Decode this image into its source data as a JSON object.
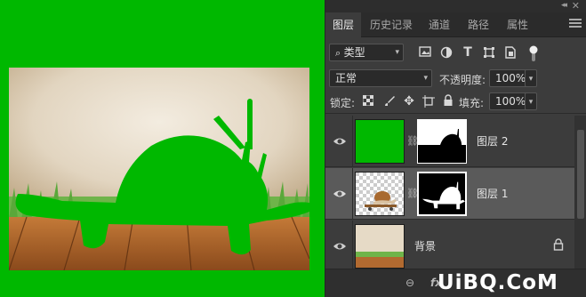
{
  "canvas": {
    "background_color": "#00b800"
  },
  "panel": {
    "tabs": [
      {
        "label": "图层",
        "active": true
      },
      {
        "label": "历史记录",
        "active": false
      },
      {
        "label": "通道",
        "active": false
      },
      {
        "label": "路径",
        "active": false
      },
      {
        "label": "属性",
        "active": false
      }
    ],
    "filter": {
      "label": "类型",
      "icons": [
        "image-filter-icon",
        "adjustment-filter-icon",
        "type-filter-icon",
        "shape-filter-icon",
        "smart-object-filter-icon",
        "filter-toggle-icon"
      ]
    },
    "blend_mode": "正常",
    "opacity": {
      "label": "不透明度:",
      "value": "100%"
    },
    "lock": {
      "label": "锁定:",
      "icons": [
        "lock-transparent-icon",
        "lock-pixels-icon",
        "lock-position-icon",
        "lock-artboard-icon",
        "lock-all-icon"
      ]
    },
    "fill": {
      "label": "填充:",
      "value": "100%"
    },
    "layers": [
      {
        "name": "图层 2",
        "selected": false,
        "visible": true,
        "thumb": "solid-green",
        "has_mask": true
      },
      {
        "name": "图层 1",
        "selected": true,
        "visible": true,
        "thumb": "snail-skateboard",
        "has_mask": true
      },
      {
        "name": "背景",
        "selected": false,
        "visible": true,
        "thumb": "background-photo",
        "locked": true
      }
    ],
    "bottom_icons": [
      "link-layers-icon",
      "fx-icon",
      "add-mask-icon",
      "adjustment-layer-icon",
      "group-icon",
      "new-layer-icon",
      "delete-layer-icon"
    ],
    "bottom_labels": {
      "link": "⊖",
      "fx": "fx"
    }
  },
  "watermark": "UiBQ.CoM"
}
